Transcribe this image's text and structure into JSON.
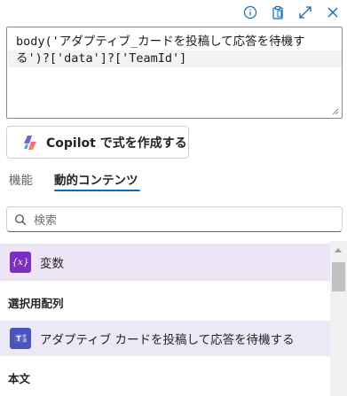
{
  "toolbar": {
    "icons": [
      "info-icon",
      "clipboard-icon",
      "expand-icon",
      "close-icon"
    ]
  },
  "editor": {
    "expression": "body('アダプティブ_カードを投稿して応答を待機する')?['data']?['TeamId']"
  },
  "copilot": {
    "label": "Copilot で式を作成する"
  },
  "tabs": [
    {
      "label": "機能",
      "active": false
    },
    {
      "label": "動的コンテンツ",
      "active": true
    }
  ],
  "search": {
    "placeholder": "検索"
  },
  "list": {
    "variables_label": "変数",
    "variables_icon_text": "{x}",
    "section_array": "選択用配列",
    "action_label": "アダプティブ カードを投稿して応答を待機する",
    "section_body": "本文"
  },
  "colors": {
    "accent": "#0f6cbd",
    "variable_icon": "#7a2ec2",
    "teams_icon": "#4b53bc",
    "highlight_row": "#ede5f6"
  }
}
